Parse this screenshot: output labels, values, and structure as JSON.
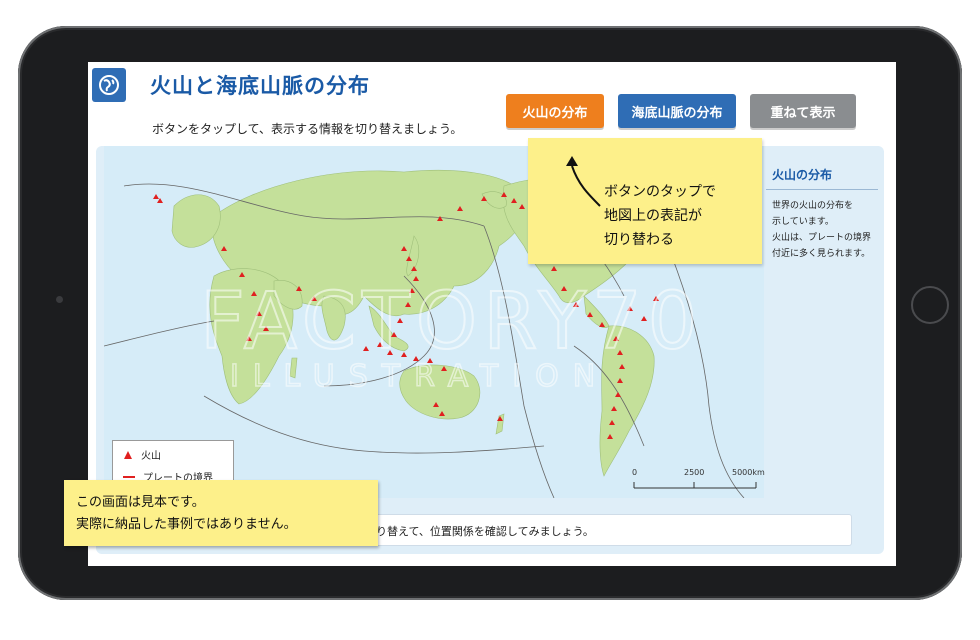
{
  "header": {
    "title": "火山と海底山脈の分布",
    "subtitle": "ボタンをタップして、表示する情報を切り替えましょう。"
  },
  "toolbar": {
    "volcano_button": "火山の分布",
    "ridge_button": "海底山脈の分布",
    "overlay_button": "重ねて表示"
  },
  "info_panel": {
    "title": "火山の分布",
    "line1": "世界の火山の分布を",
    "line2": "示しています。",
    "line3": "火山は、プレートの境界",
    "line4": "付近に多く見られます。"
  },
  "callout": {
    "line1": "ボタンのタップで",
    "line2": "地図上の表記が",
    "line3": "切り替わる"
  },
  "legend": {
    "volcano": "火山",
    "plate_boundary": "プレートの境界"
  },
  "scale": {
    "tick0": "0",
    "tick1": "2500",
    "tick2": "5000km"
  },
  "bottom_bar": {
    "text": "た状態を切り替えて、位置関係を確認してみましょう。"
  },
  "note": {
    "line1": "この画面は見本です。",
    "line2": "実際に納品した事例ではありません。"
  },
  "watermark": {
    "brand": "FACTORY70",
    "sub": "ILLUSTRATION"
  },
  "icons": {
    "logo": "globe-icon",
    "callout_pointer": "curved-arrow-icon",
    "volcano_marker": "red-triangle-icon"
  },
  "colors": {
    "title": "#1a5aa6",
    "volcano_button": "#ee7f1e",
    "ridge_button": "#2f6db5",
    "overlay_button": "#8a8d90",
    "land": "#c4e09a",
    "ocean": "#d6ecf8",
    "volcano_marker": "#e02020",
    "callout": "#fdf08a"
  }
}
